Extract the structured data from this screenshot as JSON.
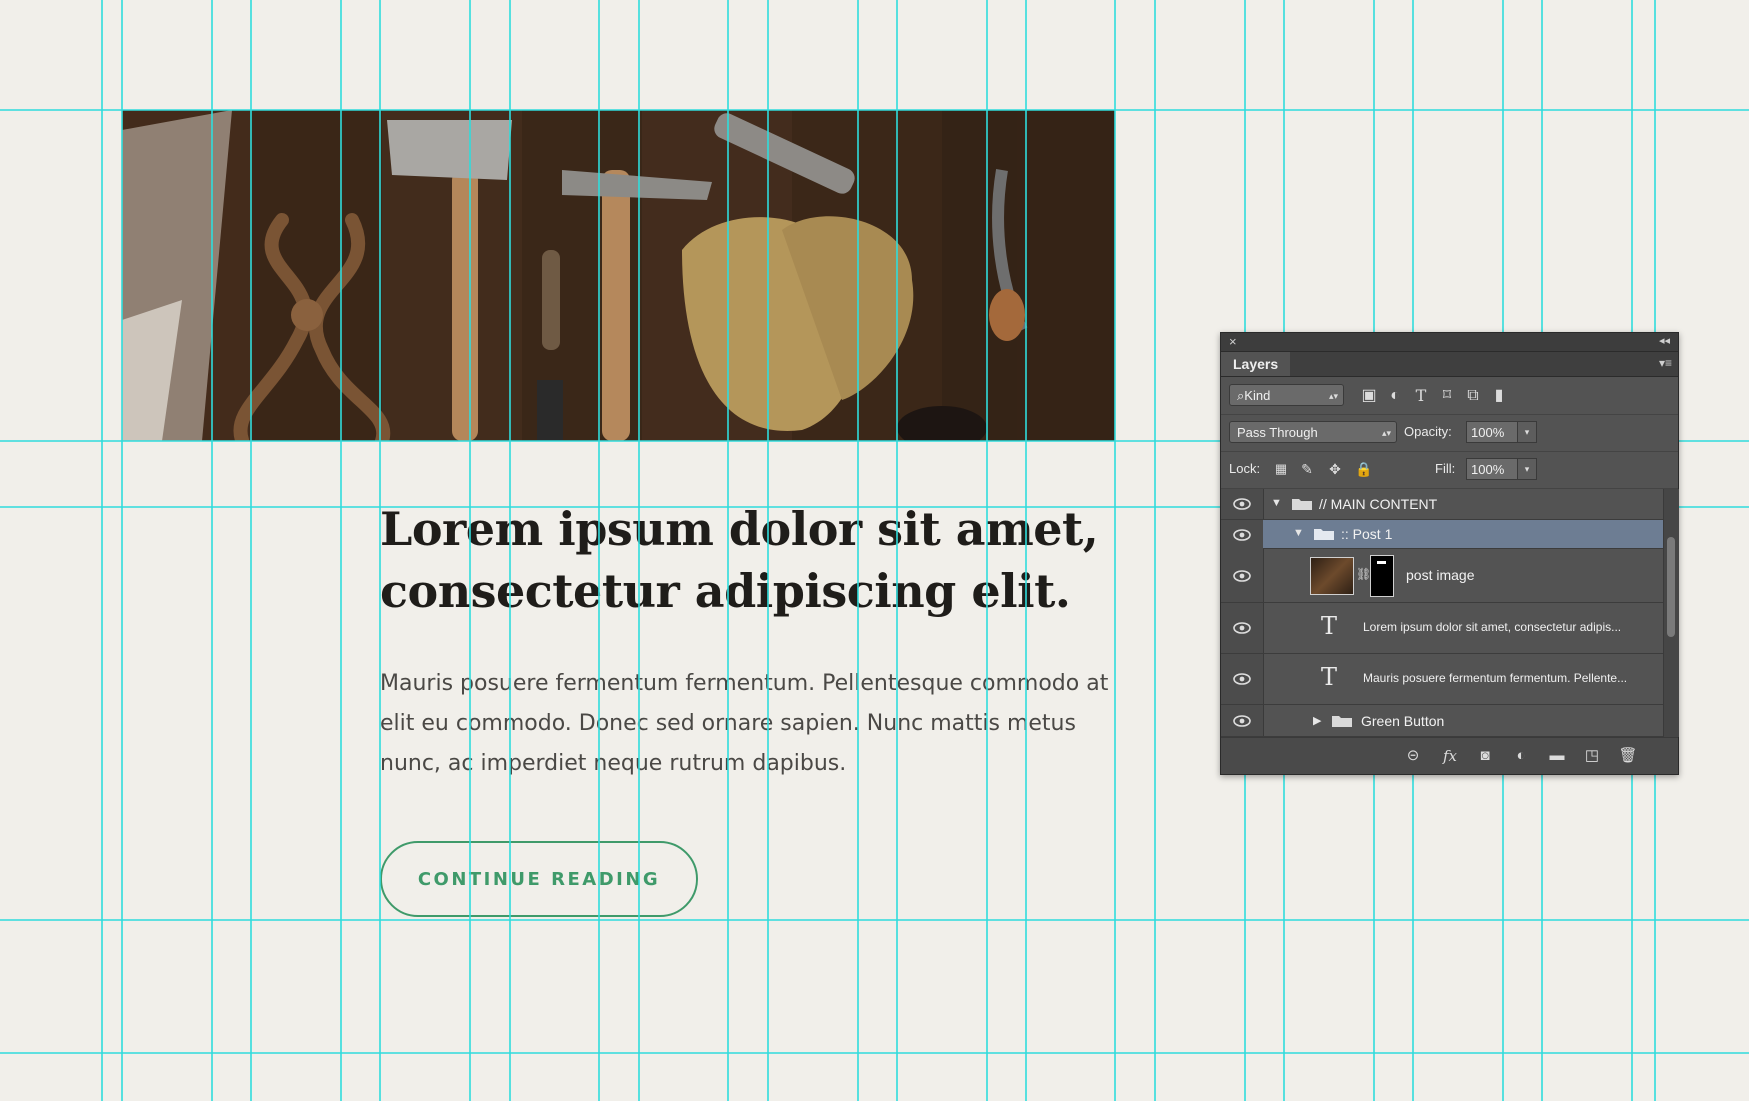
{
  "article": {
    "image_alt": "Old hand tools on a dark wooden table: pliers, axe, pocket knife, hammer, leather work gloves",
    "headline": "Lorem ipsum dolor sit amet, consectetur adipiscing elit.",
    "body": "Mauris posuere fermentum fermentum. Pellentesque commodo at elit eu commodo. Donec sed ornare sapien. Nunc mattis metus nunc, ac imperdiet neque rutrum dapibus.",
    "cta_label": "CONTINUE READING"
  },
  "colors": {
    "page_bg": "#f1efea",
    "guide": "#2fdcdc",
    "accent_green": "#3f9a6a",
    "headline": "#1f1d1a",
    "panel_bg": "#535353",
    "selected_layer": "#6d7d93"
  },
  "layers_panel": {
    "tab_label": "Layers",
    "filter": {
      "label": "Kind",
      "icons": [
        "image-filter-icon",
        "adjustment-filter-icon",
        "type-filter-icon",
        "shape-filter-icon",
        "smart-object-filter-icon",
        "filter-toggle-icon"
      ]
    },
    "blend_mode": "Pass Through",
    "opacity_label": "Opacity:",
    "opacity_value": "100%",
    "lock_label": "Lock:",
    "fill_label": "Fill:",
    "fill_value": "100%",
    "layers": [
      {
        "name": "// MAIN CONTENT",
        "type": "group",
        "expanded": true,
        "selected": false
      },
      {
        "name": ":: Post 1",
        "type": "group",
        "expanded": true,
        "selected": true
      },
      {
        "name": "post image",
        "type": "image",
        "selected": false
      },
      {
        "name": "Lorem ipsum dolor sit amet, consectetur adipis...",
        "type": "text",
        "selected": false
      },
      {
        "name": "Mauris posuere fermentum fermentum. Pellente...",
        "type": "text",
        "selected": false
      },
      {
        "name": "Green Button",
        "type": "group",
        "expanded": false,
        "selected": false
      }
    ],
    "footer_icons": [
      "link-layers-icon",
      "fx-icon",
      "add-mask-icon",
      "adjustment-layer-icon",
      "new-group-icon",
      "new-layer-icon",
      "trash-icon"
    ]
  }
}
